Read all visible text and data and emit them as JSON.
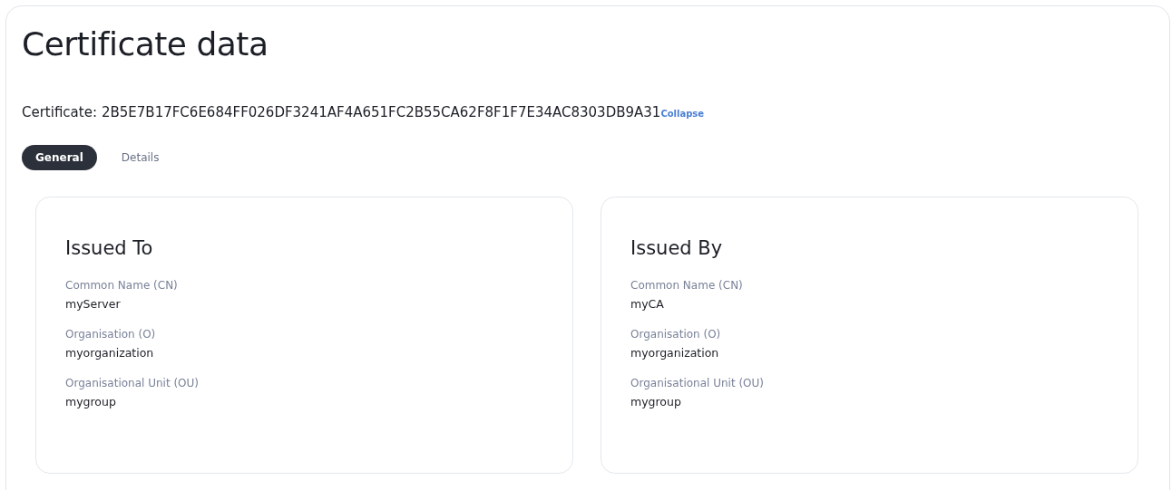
{
  "title": "Certificate data",
  "certificate": {
    "label": "Certificate:",
    "value": "2B5E7B17FC6E684FF026DF3241AF4A651FC2B55CA62F8F1F7E34AC8303DB9A31",
    "link": "Collapse"
  },
  "tabs": [
    {
      "label": "General",
      "selected": true
    },
    {
      "label": "Details",
      "selected": false
    }
  ],
  "cards": [
    {
      "title": "Issued To",
      "fields": [
        {
          "label": "Common Name (CN)",
          "value": "myServer"
        },
        {
          "label": "Organisation (O)",
          "value": "myorganization"
        },
        {
          "label": "Organisational Unit (OU)",
          "value": "mygroup"
        }
      ]
    },
    {
      "title": "Issued By",
      "fields": [
        {
          "label": "Common Name (CN)",
          "value": "myCA"
        },
        {
          "label": "Organisation (O)",
          "value": "myorganization"
        },
        {
          "label": "Organisational Unit (OU)",
          "value": "mygroup"
        }
      ]
    }
  ]
}
